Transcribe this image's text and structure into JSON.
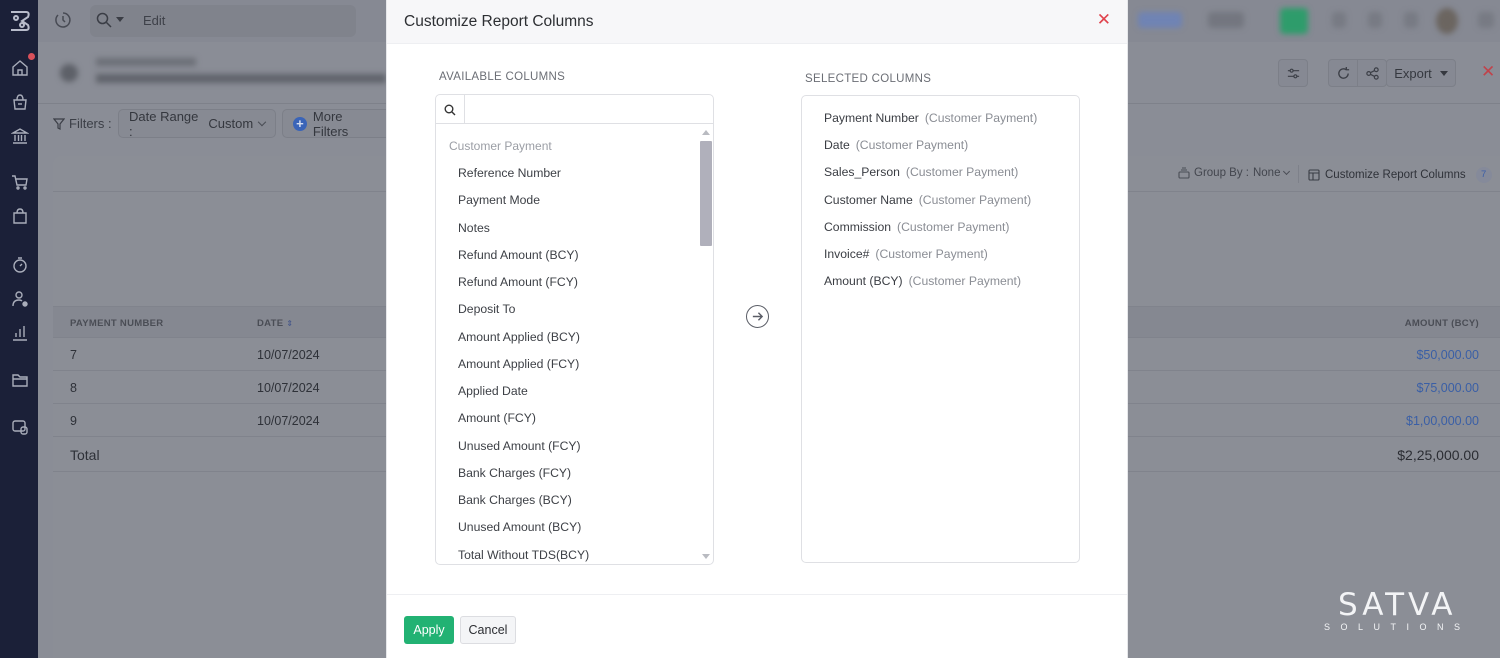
{
  "app": {
    "search_text": "Edit",
    "brand_logo": "satva-solutions",
    "watermark": {
      "main": "SATVA",
      "sub": "SOLUTIONS"
    }
  },
  "sidebar": {
    "items": [
      {
        "name": "home",
        "icon": "home-icon",
        "has_badge": true
      },
      {
        "name": "items",
        "icon": "basket-icon"
      },
      {
        "name": "banking",
        "icon": "bank-icon"
      },
      {
        "name": "sales",
        "icon": "cart-icon"
      },
      {
        "name": "purchases",
        "icon": "bag-icon"
      },
      {
        "name": "time-tracking",
        "icon": "stopwatch-icon"
      },
      {
        "name": "accountant",
        "icon": "user-gear-icon"
      },
      {
        "name": "reports",
        "icon": "bar-chart-icon"
      },
      {
        "name": "documents",
        "icon": "folder-icon"
      },
      {
        "name": "apps",
        "icon": "apps-icon"
      }
    ]
  },
  "toolbar": {
    "export_label": "Export",
    "close_icon": "close-icon"
  },
  "filters": {
    "label": "Filters :",
    "date_range_label": "Date Range :",
    "date_range_value": "Custom",
    "more_filters_label": "More Filters"
  },
  "report": {
    "group_by_label": "Group By :",
    "group_by_value": "None",
    "customize_label": "Customize Report Columns",
    "customize_count": "7",
    "columns": [
      "PAYMENT NUMBER",
      "DATE",
      "AMOUNT (BCY)"
    ],
    "rows": [
      {
        "payment_number": "7",
        "date": "10/07/2024",
        "amount": "$50,000.00"
      },
      {
        "payment_number": "8",
        "date": "10/07/2024",
        "amount": "$75,000.00"
      },
      {
        "payment_number": "9",
        "date": "10/07/2024",
        "amount": "$1,00,000.00"
      }
    ],
    "total_label": "Total",
    "total_amount": "$2,25,000.00"
  },
  "modal": {
    "title": "Customize Report Columns",
    "available_label": "AVAILABLE COLUMNS",
    "selected_label": "SELECTED COLUMNS",
    "search_placeholder": "",
    "search_value": "",
    "available_group": "Customer Payment",
    "available_items": [
      "Reference Number",
      "Payment Mode",
      "Notes",
      "Refund Amount (BCY)",
      "Refund Amount (FCY)",
      "Deposit To",
      "Amount Applied (BCY)",
      "Amount Applied (FCY)",
      "Applied Date",
      "Amount (FCY)",
      "Unused Amount (FCY)",
      "Bank Charges (FCY)",
      "Bank Charges (BCY)",
      "Unused Amount (BCY)",
      "Total Without TDS(BCY)"
    ],
    "selected_items": [
      {
        "name": "Payment Number",
        "source": "(Customer Payment)"
      },
      {
        "name": "Date",
        "source": "(Customer Payment)"
      },
      {
        "name": "Sales_Person",
        "source": "(Customer Payment)"
      },
      {
        "name": "Customer Name",
        "source": "(Customer Payment)"
      },
      {
        "name": "Commission",
        "source": "(Customer Payment)"
      },
      {
        "name": "Invoice#",
        "source": "(Customer Payment)"
      },
      {
        "name": "Amount (BCY)",
        "source": "(Customer Payment)"
      }
    ],
    "apply_label": "Apply",
    "cancel_label": "Cancel",
    "colors": {
      "apply": "#22b273",
      "close": "#e0434d"
    }
  }
}
